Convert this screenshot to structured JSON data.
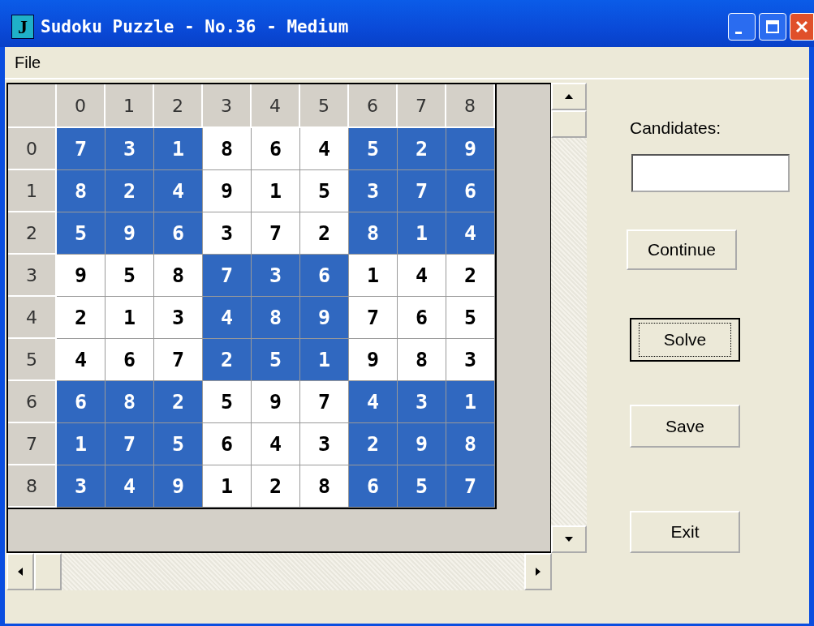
{
  "window": {
    "icon_letter": "J",
    "title": "Sudoku Puzzle - No.36 - Medium"
  },
  "menu": [
    "File"
  ],
  "grid": {
    "columns": [
      "0",
      "1",
      "2",
      "3",
      "4",
      "5",
      "6",
      "7",
      "8"
    ],
    "rows": [
      {
        "label": "0",
        "cells": [
          {
            "value": "7",
            "shaded": true
          },
          {
            "value": "3",
            "shaded": true
          },
          {
            "value": "1",
            "shaded": true
          },
          {
            "value": "8",
            "shaded": false
          },
          {
            "value": "6",
            "shaded": false
          },
          {
            "value": "4",
            "shaded": false
          },
          {
            "value": "5",
            "shaded": true
          },
          {
            "value": "2",
            "shaded": true
          },
          {
            "value": "9",
            "shaded": true
          }
        ]
      },
      {
        "label": "1",
        "cells": [
          {
            "value": "8",
            "shaded": true
          },
          {
            "value": "2",
            "shaded": true
          },
          {
            "value": "4",
            "shaded": true
          },
          {
            "value": "9",
            "shaded": false
          },
          {
            "value": "1",
            "shaded": false
          },
          {
            "value": "5",
            "shaded": false
          },
          {
            "value": "3",
            "shaded": true
          },
          {
            "value": "7",
            "shaded": true
          },
          {
            "value": "6",
            "shaded": true
          }
        ]
      },
      {
        "label": "2",
        "cells": [
          {
            "value": "5",
            "shaded": true
          },
          {
            "value": "9",
            "shaded": true
          },
          {
            "value": "6",
            "shaded": true
          },
          {
            "value": "3",
            "shaded": false
          },
          {
            "value": "7",
            "shaded": false
          },
          {
            "value": "2",
            "shaded": false
          },
          {
            "value": "8",
            "shaded": true
          },
          {
            "value": "1",
            "shaded": true
          },
          {
            "value": "4",
            "shaded": true
          }
        ]
      },
      {
        "label": "3",
        "cells": [
          {
            "value": "9",
            "shaded": false
          },
          {
            "value": "5",
            "shaded": false
          },
          {
            "value": "8",
            "shaded": false
          },
          {
            "value": "7",
            "shaded": true
          },
          {
            "value": "3",
            "shaded": true
          },
          {
            "value": "6",
            "shaded": true
          },
          {
            "value": "1",
            "shaded": false
          },
          {
            "value": "4",
            "shaded": false
          },
          {
            "value": "2",
            "shaded": false
          }
        ]
      },
      {
        "label": "4",
        "cells": [
          {
            "value": "2",
            "shaded": false
          },
          {
            "value": "1",
            "shaded": false
          },
          {
            "value": "3",
            "shaded": false
          },
          {
            "value": "4",
            "shaded": true
          },
          {
            "value": "8",
            "shaded": true
          },
          {
            "value": "9",
            "shaded": true
          },
          {
            "value": "7",
            "shaded": false
          },
          {
            "value": "6",
            "shaded": false
          },
          {
            "value": "5",
            "shaded": false
          }
        ]
      },
      {
        "label": "5",
        "cells": [
          {
            "value": "4",
            "shaded": false
          },
          {
            "value": "6",
            "shaded": false
          },
          {
            "value": "7",
            "shaded": false
          },
          {
            "value": "2",
            "shaded": true
          },
          {
            "value": "5",
            "shaded": true
          },
          {
            "value": "1",
            "shaded": true
          },
          {
            "value": "9",
            "shaded": false
          },
          {
            "value": "8",
            "shaded": false
          },
          {
            "value": "3",
            "shaded": false
          }
        ]
      },
      {
        "label": "6",
        "cells": [
          {
            "value": "6",
            "shaded": true
          },
          {
            "value": "8",
            "shaded": true
          },
          {
            "value": "2",
            "shaded": true
          },
          {
            "value": "5",
            "shaded": false
          },
          {
            "value": "9",
            "shaded": false
          },
          {
            "value": "7",
            "shaded": false
          },
          {
            "value": "4",
            "shaded": true
          },
          {
            "value": "3",
            "shaded": true
          },
          {
            "value": "1",
            "shaded": true
          }
        ]
      },
      {
        "label": "7",
        "cells": [
          {
            "value": "1",
            "shaded": true
          },
          {
            "value": "7",
            "shaded": true
          },
          {
            "value": "5",
            "shaded": true
          },
          {
            "value": "6",
            "shaded": false
          },
          {
            "value": "4",
            "shaded": false
          },
          {
            "value": "3",
            "shaded": false
          },
          {
            "value": "2",
            "shaded": true
          },
          {
            "value": "9",
            "shaded": true
          },
          {
            "value": "8",
            "shaded": true
          }
        ]
      },
      {
        "label": "8",
        "cells": [
          {
            "value": "3",
            "shaded": true
          },
          {
            "value": "4",
            "shaded": true
          },
          {
            "value": "9",
            "shaded": true
          },
          {
            "value": "1",
            "shaded": false
          },
          {
            "value": "2",
            "shaded": false
          },
          {
            "value": "8",
            "shaded": false
          },
          {
            "value": "6",
            "shaded": true
          },
          {
            "value": "5",
            "shaded": true
          },
          {
            "value": "7",
            "shaded": true
          }
        ]
      }
    ]
  },
  "candidates": {
    "label": "Candidates:"
  },
  "buttons": [
    {
      "label": "Continue",
      "focused": false
    },
    {
      "label": "Solve",
      "focused": true
    },
    {
      "label": "Save",
      "focused": false
    },
    {
      "label": "Exit",
      "focused": false
    }
  ]
}
